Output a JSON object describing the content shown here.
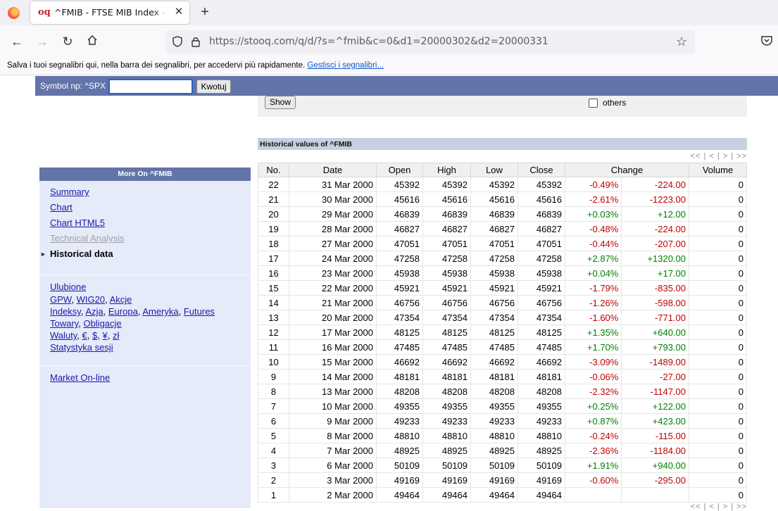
{
  "browser": {
    "tab_title": "^FMIB - FTSE MIB Index - Italy - Stooq",
    "tab_favicon": "oq",
    "url": "https://stooq.com/q/d/?s=^fmib&c=0&d1=20000302&d2=20000331",
    "bookmarks_text": "Salva i tuoi segnalibri qui, nella barra dei segnalibri, per accedervi più rapidamente.",
    "bookmarks_link": "Gestisci i segnalibri..."
  },
  "symbol_bar": {
    "label": "Symbol np: ^SPX",
    "input_value": "",
    "button": "Kwotuj"
  },
  "filter": {
    "show_button": "Show",
    "others_label": "others",
    "others_checked": false
  },
  "historical": {
    "title": "Historical values of ^FMIB",
    "pager": "<< | < | > | >>",
    "columns": [
      "No.",
      "Date",
      "Open",
      "High",
      "Low",
      "Close",
      "Change",
      "Volume"
    ],
    "rows": [
      {
        "no": "22",
        "date": "31 Mar 2000",
        "open": "45392",
        "high": "45392",
        "low": "45392",
        "close": "45392",
        "pct": "-0.49%",
        "abs": "-224.00",
        "volume": "0"
      },
      {
        "no": "21",
        "date": "30 Mar 2000",
        "open": "45616",
        "high": "45616",
        "low": "45616",
        "close": "45616",
        "pct": "-2.61%",
        "abs": "-1223.00",
        "volume": "0"
      },
      {
        "no": "20",
        "date": "29 Mar 2000",
        "open": "46839",
        "high": "46839",
        "low": "46839",
        "close": "46839",
        "pct": "+0.03%",
        "abs": "+12.00",
        "volume": "0"
      },
      {
        "no": "19",
        "date": "28 Mar 2000",
        "open": "46827",
        "high": "46827",
        "low": "46827",
        "close": "46827",
        "pct": "-0.48%",
        "abs": "-224.00",
        "volume": "0"
      },
      {
        "no": "18",
        "date": "27 Mar 2000",
        "open": "47051",
        "high": "47051",
        "low": "47051",
        "close": "47051",
        "pct": "-0.44%",
        "abs": "-207.00",
        "volume": "0"
      },
      {
        "no": "17",
        "date": "24 Mar 2000",
        "open": "47258",
        "high": "47258",
        "low": "47258",
        "close": "47258",
        "pct": "+2.87%",
        "abs": "+1320.00",
        "volume": "0"
      },
      {
        "no": "16",
        "date": "23 Mar 2000",
        "open": "45938",
        "high": "45938",
        "low": "45938",
        "close": "45938",
        "pct": "+0.04%",
        "abs": "+17.00",
        "volume": "0"
      },
      {
        "no": "15",
        "date": "22 Mar 2000",
        "open": "45921",
        "high": "45921",
        "low": "45921",
        "close": "45921",
        "pct": "-1.79%",
        "abs": "-835.00",
        "volume": "0"
      },
      {
        "no": "14",
        "date": "21 Mar 2000",
        "open": "46756",
        "high": "46756",
        "low": "46756",
        "close": "46756",
        "pct": "-1.26%",
        "abs": "-598.00",
        "volume": "0"
      },
      {
        "no": "13",
        "date": "20 Mar 2000",
        "open": "47354",
        "high": "47354",
        "low": "47354",
        "close": "47354",
        "pct": "-1.60%",
        "abs": "-771.00",
        "volume": "0"
      },
      {
        "no": "12",
        "date": "17 Mar 2000",
        "open": "48125",
        "high": "48125",
        "low": "48125",
        "close": "48125",
        "pct": "+1.35%",
        "abs": "+640.00",
        "volume": "0"
      },
      {
        "no": "11",
        "date": "16 Mar 2000",
        "open": "47485",
        "high": "47485",
        "low": "47485",
        "close": "47485",
        "pct": "+1.70%",
        "abs": "+793.00",
        "volume": "0"
      },
      {
        "no": "10",
        "date": "15 Mar 2000",
        "open": "46692",
        "high": "46692",
        "low": "46692",
        "close": "46692",
        "pct": "-3.09%",
        "abs": "-1489.00",
        "volume": "0"
      },
      {
        "no": "9",
        "date": "14 Mar 2000",
        "open": "48181",
        "high": "48181",
        "low": "48181",
        "close": "48181",
        "pct": "-0.06%",
        "abs": "-27.00",
        "volume": "0"
      },
      {
        "no": "8",
        "date": "13 Mar 2000",
        "open": "48208",
        "high": "48208",
        "low": "48208",
        "close": "48208",
        "pct": "-2.32%",
        "abs": "-1147.00",
        "volume": "0"
      },
      {
        "no": "7",
        "date": "10 Mar 2000",
        "open": "49355",
        "high": "49355",
        "low": "49355",
        "close": "49355",
        "pct": "+0.25%",
        "abs": "+122.00",
        "volume": "0"
      },
      {
        "no": "6",
        "date": "9 Mar 2000",
        "open": "49233",
        "high": "49233",
        "low": "49233",
        "close": "49233",
        "pct": "+0.87%",
        "abs": "+423.00",
        "volume": "0"
      },
      {
        "no": "5",
        "date": "8 Mar 2000",
        "open": "48810",
        "high": "48810",
        "low": "48810",
        "close": "48810",
        "pct": "-0.24%",
        "abs": "-115.00",
        "volume": "0"
      },
      {
        "no": "4",
        "date": "7 Mar 2000",
        "open": "48925",
        "high": "48925",
        "low": "48925",
        "close": "48925",
        "pct": "-2.36%",
        "abs": "-1184.00",
        "volume": "0"
      },
      {
        "no": "3",
        "date": "6 Mar 2000",
        "open": "50109",
        "high": "50109",
        "low": "50109",
        "close": "50109",
        "pct": "+1.91%",
        "abs": "+940.00",
        "volume": "0"
      },
      {
        "no": "2",
        "date": "3 Mar 2000",
        "open": "49169",
        "high": "49169",
        "low": "49169",
        "close": "49169",
        "pct": "-0.60%",
        "abs": "-295.00",
        "volume": "0"
      },
      {
        "no": "1",
        "date": "2 Mar 2000",
        "open": "49464",
        "high": "49464",
        "low": "49464",
        "close": "49464",
        "pct": "",
        "abs": "",
        "volume": "0"
      }
    ]
  },
  "sidebar": {
    "header": "More On ^FMIB",
    "nav": [
      {
        "label": "Summary",
        "state": "link"
      },
      {
        "label": "Chart",
        "state": "link"
      },
      {
        "label": "Chart HTML5",
        "state": "link"
      },
      {
        "label": "Technical Analysis",
        "state": "disabled"
      },
      {
        "label": "Historical data",
        "state": "active"
      }
    ],
    "markets": {
      "ulubione": "Ulubione",
      "line2": [
        "GPW",
        "WIG20",
        "Akcje"
      ],
      "line3": [
        "Indeksy",
        "Azja",
        "Europa",
        "Ameryka",
        "Futures"
      ],
      "line4": [
        "Towary",
        "Obligacje"
      ],
      "waluty_label": "Waluty",
      "currencies": [
        "€",
        "$",
        "¥",
        "zł"
      ],
      "stats": "Statystyka sesji"
    },
    "online": "Market On-line"
  },
  "colors": {
    "positive": "#008000",
    "negative": "#c00000",
    "header_bar": "#6374a8",
    "sidebar_bg": "#e5ebf9"
  }
}
